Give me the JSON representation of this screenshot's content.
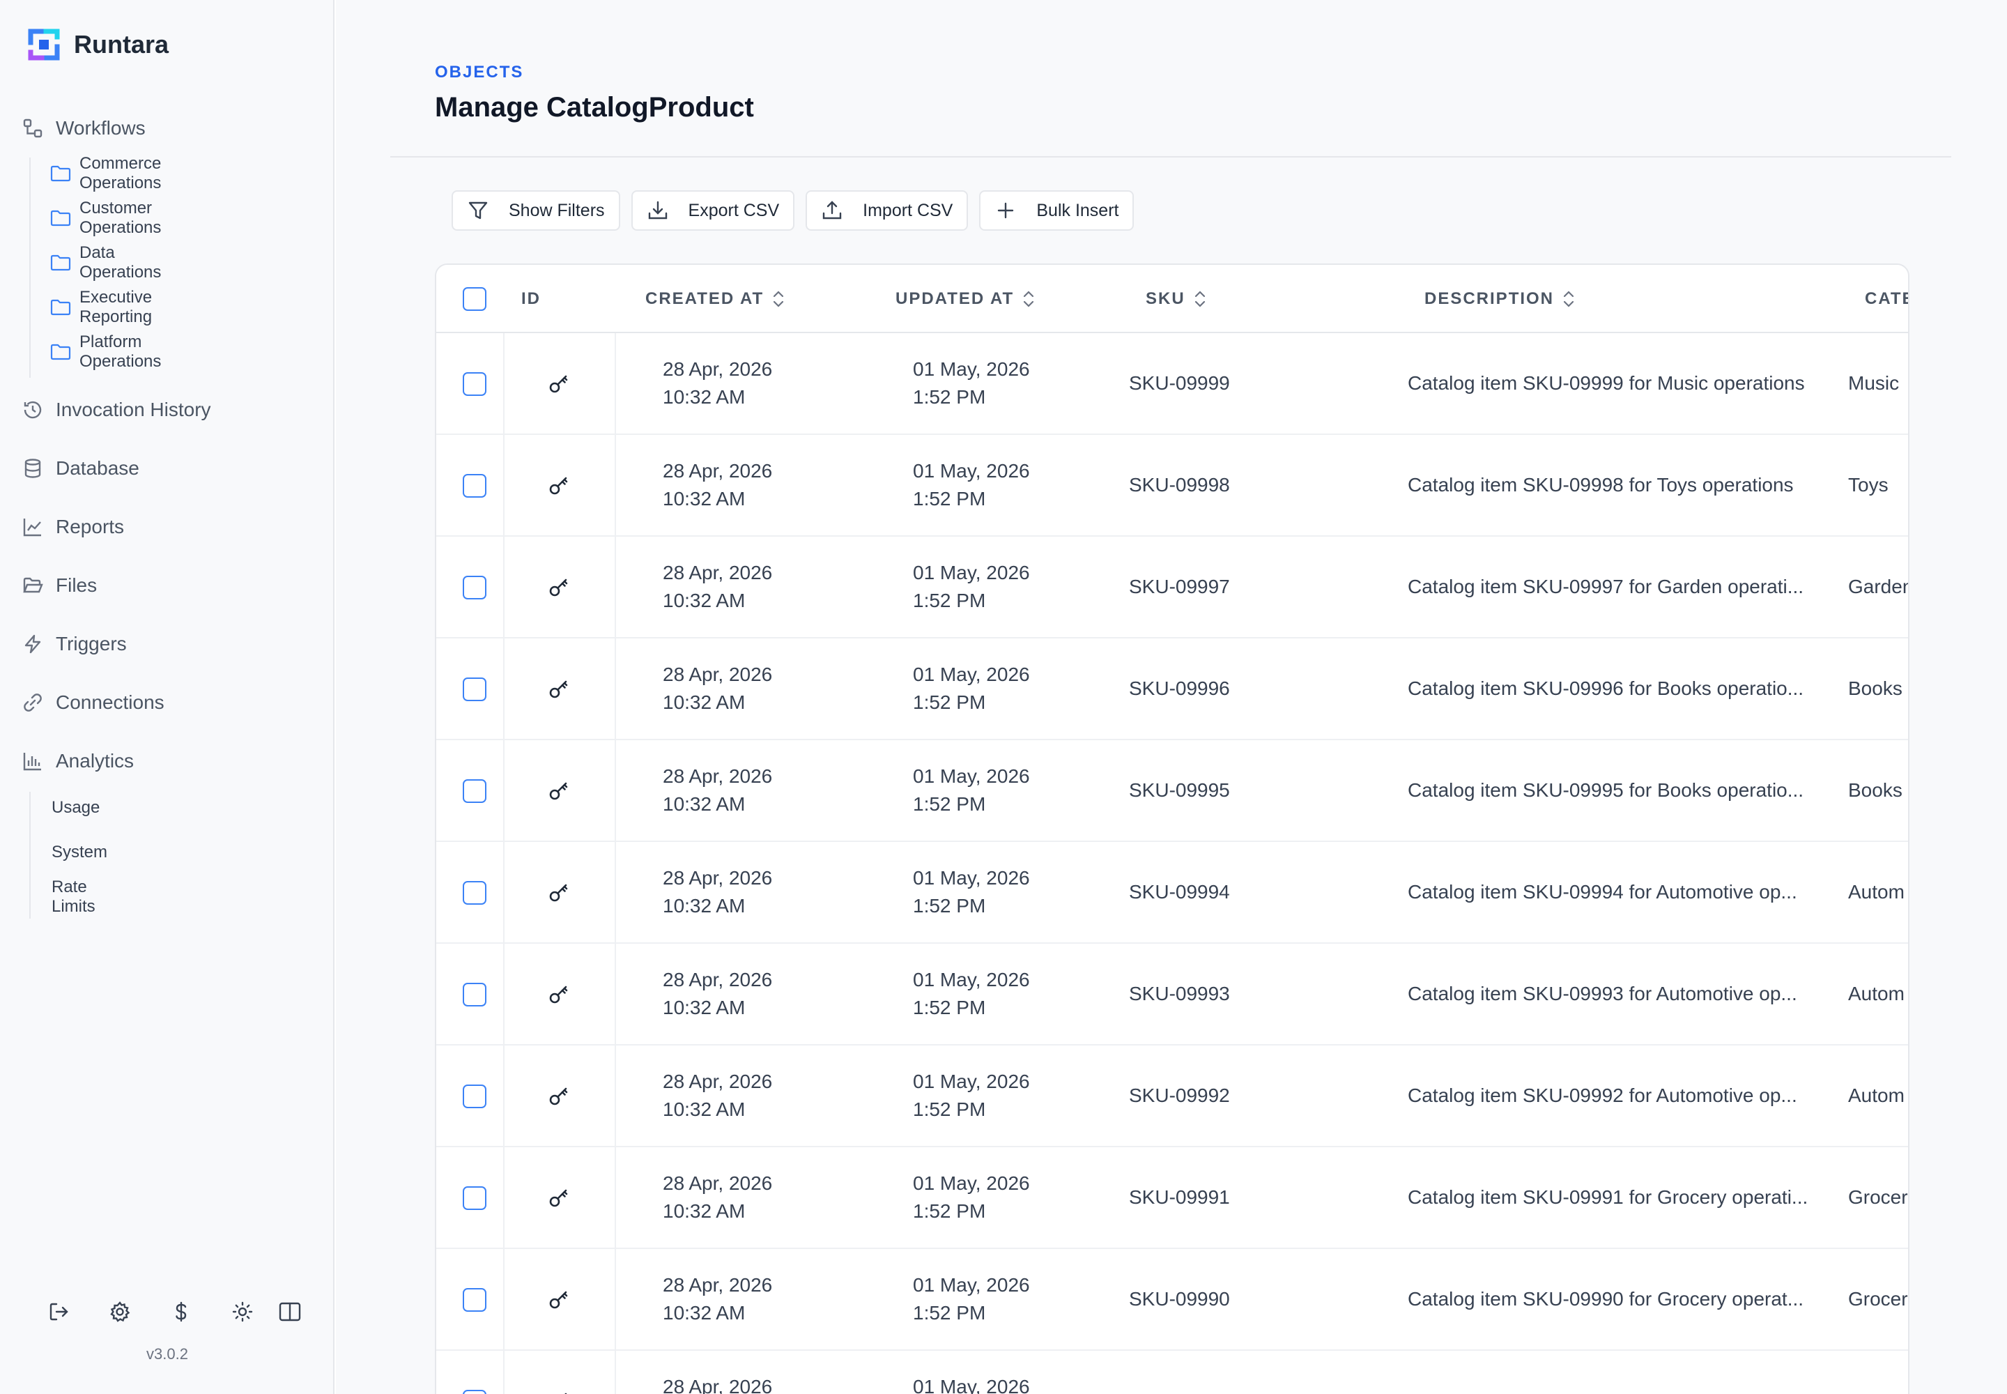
{
  "brand": {
    "name": "Runtara"
  },
  "sidebar": {
    "workflows": {
      "label": "Workflows",
      "folders": [
        "Commerce Operations",
        "Customer Operations",
        "Data Operations",
        "Executive Reporting",
        "Platform Operations"
      ]
    },
    "items": [
      {
        "label": "Invocation History",
        "icon": "history-icon"
      },
      {
        "label": "Database",
        "icon": "database-icon"
      },
      {
        "label": "Reports",
        "icon": "chart-line-icon"
      },
      {
        "label": "Files",
        "icon": "folder-open-icon"
      },
      {
        "label": "Triggers",
        "icon": "lightning-icon"
      },
      {
        "label": "Connections",
        "icon": "link-icon"
      }
    ],
    "analytics": {
      "label": "Analytics",
      "subitems": [
        "Usage",
        "System",
        "Rate Limits"
      ]
    },
    "version": "v3.0.2"
  },
  "header": {
    "eyebrow": "OBJECTS",
    "title": "Manage CatalogProduct"
  },
  "toolbar": {
    "show_filters": "Show Filters",
    "export_csv": "Export CSV",
    "import_csv": "Import CSV",
    "bulk_insert": "Bulk Insert"
  },
  "table": {
    "columns": {
      "id": "ID",
      "created_at": "CREATED AT",
      "updated_at": "UPDATED AT",
      "sku": "SKU",
      "description": "DESCRIPTION",
      "category": "CATE"
    },
    "rows": [
      {
        "created_date": "28 Apr, 2026",
        "created_time": "10:32 AM",
        "updated_date": "01 May, 2026",
        "updated_time": "1:52 PM",
        "sku": "SKU-09999",
        "description": "Catalog item SKU-09999 for Music operations",
        "category": "Music"
      },
      {
        "created_date": "28 Apr, 2026",
        "created_time": "10:32 AM",
        "updated_date": "01 May, 2026",
        "updated_time": "1:52 PM",
        "sku": "SKU-09998",
        "description": "Catalog item SKU-09998 for Toys operations",
        "category": "Toys"
      },
      {
        "created_date": "28 Apr, 2026",
        "created_time": "10:32 AM",
        "updated_date": "01 May, 2026",
        "updated_time": "1:52 PM",
        "sku": "SKU-09997",
        "description": "Catalog item SKU-09997 for Garden operati...",
        "category": "Garden"
      },
      {
        "created_date": "28 Apr, 2026",
        "created_time": "10:32 AM",
        "updated_date": "01 May, 2026",
        "updated_time": "1:52 PM",
        "sku": "SKU-09996",
        "description": "Catalog item SKU-09996 for Books operatio...",
        "category": "Books"
      },
      {
        "created_date": "28 Apr, 2026",
        "created_time": "10:32 AM",
        "updated_date": "01 May, 2026",
        "updated_time": "1:52 PM",
        "sku": "SKU-09995",
        "description": "Catalog item SKU-09995 for Books operatio...",
        "category": "Books"
      },
      {
        "created_date": "28 Apr, 2026",
        "created_time": "10:32 AM",
        "updated_date": "01 May, 2026",
        "updated_time": "1:52 PM",
        "sku": "SKU-09994",
        "description": "Catalog item SKU-09994 for Automotive op...",
        "category": "Autom"
      },
      {
        "created_date": "28 Apr, 2026",
        "created_time": "10:32 AM",
        "updated_date": "01 May, 2026",
        "updated_time": "1:52 PM",
        "sku": "SKU-09993",
        "description": "Catalog item SKU-09993 for Automotive op...",
        "category": "Autom"
      },
      {
        "created_date": "28 Apr, 2026",
        "created_time": "10:32 AM",
        "updated_date": "01 May, 2026",
        "updated_time": "1:52 PM",
        "sku": "SKU-09992",
        "description": "Catalog item SKU-09992 for Automotive op...",
        "category": "Autom"
      },
      {
        "created_date": "28 Apr, 2026",
        "created_time": "10:32 AM",
        "updated_date": "01 May, 2026",
        "updated_time": "1:52 PM",
        "sku": "SKU-09991",
        "description": "Catalog item SKU-09991 for Grocery operati...",
        "category": "Grocer"
      },
      {
        "created_date": "28 Apr, 2026",
        "created_time": "10:32 AM",
        "updated_date": "01 May, 2026",
        "updated_time": "1:52 PM",
        "sku": "SKU-09990",
        "description": "Catalog item SKU-09990 for Grocery operat...",
        "category": "Grocer"
      },
      {
        "created_date": "28 Apr, 2026",
        "created_time": "",
        "updated_date": "01 May, 2026",
        "updated_time": "",
        "sku": "",
        "description": "",
        "category": ""
      }
    ]
  },
  "colors": {
    "accent": "#2563eb",
    "checkbox": "#3b82f6",
    "border": "#e5e7eb"
  }
}
